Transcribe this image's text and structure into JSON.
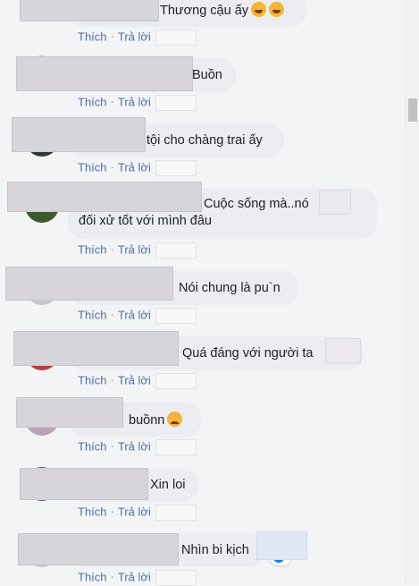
{
  "actions": {
    "like": "Thích",
    "reply": "Trả lời",
    "separator": "·"
  },
  "comments": [
    {
      "text": "Thương cậu ấy",
      "emojis": [
        "laughing-crying-emoji-icon",
        "laughing-crying-emoji-icon"
      ]
    },
    {
      "text": "Buồn"
    },
    {
      "text": "tội cho chàng trai ấy"
    },
    {
      "lines": [
        "Cuộc sống mà..nó",
        "đối xử tốt với mình đâu"
      ]
    },
    {
      "text": "Nói chung là pu`n"
    },
    {
      "text": "Quá đáng với người ta"
    },
    {
      "text": "buồnn",
      "emojis": [
        "sad-face-emoji-icon"
      ]
    },
    {
      "text": "Xin loi"
    },
    {
      "text": "Nhìn bi kịch"
    }
  ]
}
